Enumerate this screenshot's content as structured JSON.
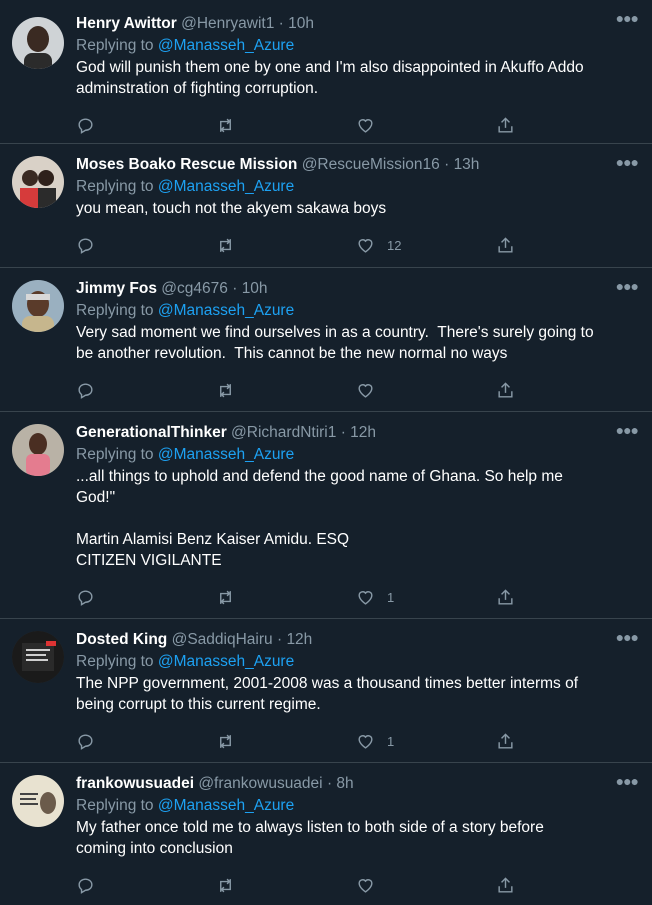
{
  "colors": {
    "background": "#15202b",
    "text": "#ffffff",
    "secondary": "#8899a6",
    "link": "#1da1f2",
    "divider": "#38444d"
  },
  "tweets": [
    {
      "name": "Henry Awittor",
      "handle": "@Henryawit1",
      "sep": "·",
      "time": "10h",
      "replying_prefix": "Replying to",
      "replying_to": "@Manasseh_Azure",
      "text": "God will punish them one by one and I'm also disappointed in Akuffo Addo\nadminstration of fighting corruption.",
      "likes": ""
    },
    {
      "name": "Moses Boako Rescue Mission",
      "handle": "@RescueMission16",
      "sep": "·",
      "time": "13h",
      "replying_prefix": "Replying to",
      "replying_to": "@Manasseh_Azure",
      "text": "you mean, touch not the akyem sakawa boys",
      "likes": "12"
    },
    {
      "name": "Jimmy Fos",
      "handle": "@cg4676",
      "sep": "·",
      "time": "10h",
      "replying_prefix": "Replying to",
      "replying_to": "@Manasseh_Azure",
      "text": "Very sad moment we find ourselves in as a country.  There's surely going to\nbe another revolution.  This cannot be the new normal no ways",
      "likes": ""
    },
    {
      "name": "GenerationalThinker",
      "handle": "@RichardNtiri1",
      "sep": "·",
      "time": "12h",
      "replying_prefix": "Replying to",
      "replying_to": "@Manasseh_Azure",
      "text": "...all things to uphold and defend the good name of Ghana. So help me\nGod!\"\n\nMartin Alamisi Benz Kaiser Amidu. ESQ\nCITIZEN VIGILANTE",
      "likes": "1"
    },
    {
      "name": "Dosted King",
      "handle": "@SaddiqHairu",
      "sep": "·",
      "time": "12h",
      "replying_prefix": "Replying to",
      "replying_to": "@Manasseh_Azure",
      "text": "The NPP government, 2001-2008 was a thousand times better interms of\nbeing corrupt to this current regime.",
      "likes": "1"
    },
    {
      "name": "frankowusuadei",
      "handle": "@frankowusuadei",
      "sep": "·",
      "time": "8h",
      "replying_prefix": "Replying to",
      "replying_to": "@Manasseh_Azure",
      "text": "My father once told me to always listen to both side of a story before\ncoming into conclusion",
      "likes": ""
    }
  ]
}
